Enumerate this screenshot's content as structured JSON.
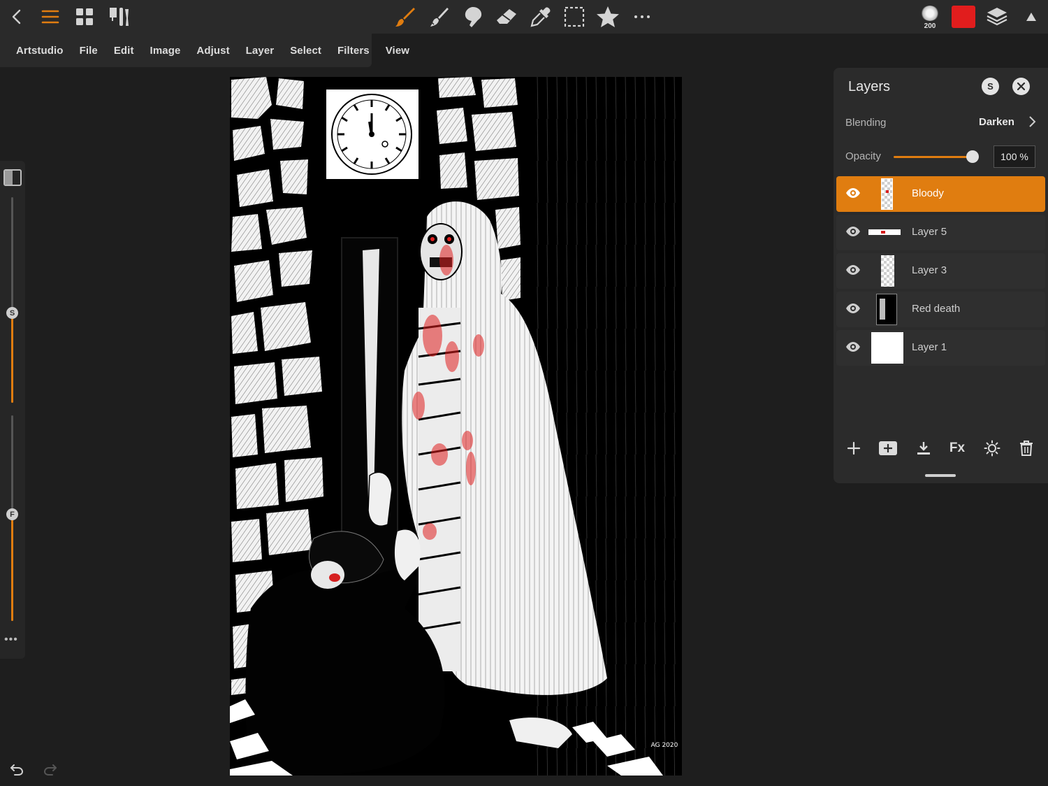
{
  "app": {
    "accent_color": "#e07d10",
    "primary_color": "#e11d1d"
  },
  "toolbar": {
    "left_icons": [
      "back-chevron-icon",
      "hamburger-menu-icon",
      "gallery-grid-icon",
      "tool-settings-icon"
    ],
    "tool_icons": [
      "brush-icon",
      "smudge-icon",
      "blur-icon",
      "eraser-icon",
      "eyedropper-icon",
      "selection-marquee-icon",
      "favorites-star-icon",
      "more-icon"
    ],
    "brush_size": "200",
    "right_icons": [
      "layers-stack-icon",
      "collapse-triangle-icon"
    ]
  },
  "menu": {
    "items": [
      "Artstudio",
      "File",
      "Edit",
      "Image",
      "Adjust",
      "Layer",
      "Select",
      "Filters",
      "View"
    ]
  },
  "side_rail": {
    "size_slider_label": "S",
    "size_slider_value": 0.44,
    "flow_slider_label": "F",
    "flow_slider_value": 0.52,
    "more_label": "•••"
  },
  "layers_panel": {
    "title": "Layers",
    "s_button": "S",
    "blending_label": "Blending",
    "blending_value": "Darken",
    "opacity_label": "Opacity",
    "opacity_value": "100 %",
    "opacity_fraction": 1.0,
    "layers": [
      {
        "name": "Bloody",
        "visible": true,
        "active": true
      },
      {
        "name": "Layer 5",
        "visible": true,
        "active": false
      },
      {
        "name": "Layer 3",
        "visible": true,
        "active": false
      },
      {
        "name": "Red death",
        "visible": true,
        "active": false
      },
      {
        "name": "Layer 1",
        "visible": true,
        "active": false
      }
    ],
    "footer_fx_label": "Fx",
    "footer_icons": [
      "add-layer-icon",
      "add-group-icon",
      "merge-down-icon",
      "fx-icon",
      "adjust-brightness-icon",
      "delete-layer-icon"
    ]
  },
  "canvas": {
    "signature": "AG 2020"
  }
}
